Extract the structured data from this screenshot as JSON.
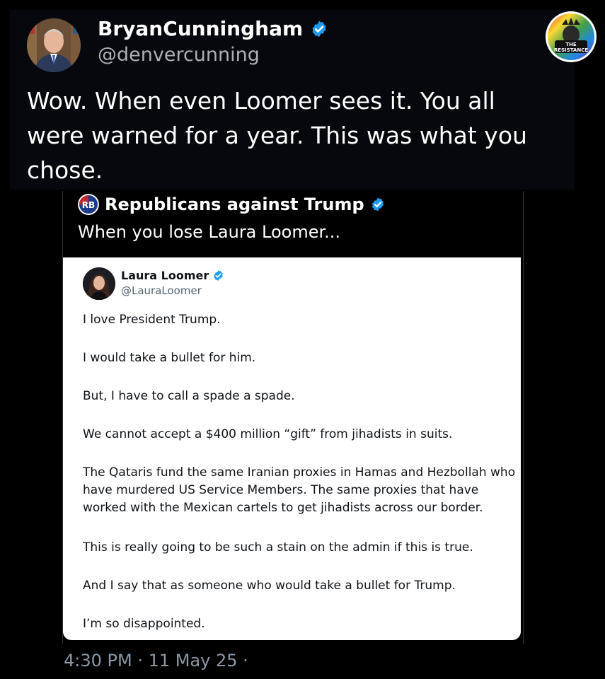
{
  "tweet": {
    "author_name": "BryanCunningham",
    "author_handle": "@denvercunning",
    "text": "Wow. When even Loomer sees it. You all were warned for a year. This was what you chose.",
    "timestamp": "4:30 PM · 11 May 25 ·"
  },
  "logo": {
    "line1": "THE",
    "line2": "RESISTANCE"
  },
  "quote": {
    "account_name": "Republicans against Trump",
    "icon_text": "RB",
    "text": "When you lose Laura Loomer...",
    "embedded": {
      "name": "Laura Loomer",
      "handle": "@LauraLoomer",
      "paragraphs": [
        "I love President Trump.",
        "I would take a bullet for him.",
        "But, I have to call a spade a spade.",
        "We cannot accept a $400 million “gift” from jihadists in suits.",
        "The Qataris fund the same Iranian proxies in Hamas and Hezbollah who",
        "have murdered US Service Members. The same proxies that have",
        "worked with the Mexican cartels to get jihadists across our border.",
        "This is really going to be such a stain on the admin if this is true.",
        "And I say that as someone who would take a bullet for Trump.",
        "I’m so disappointed."
      ]
    }
  },
  "colors": {
    "verified": "#1d9bf0",
    "background": "#000000",
    "card": "#06080d"
  }
}
